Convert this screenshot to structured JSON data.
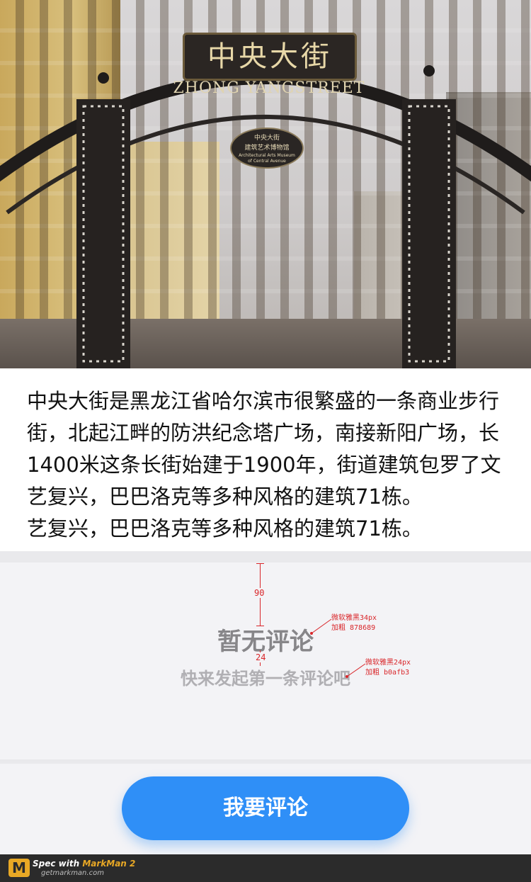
{
  "hero": {
    "sign_cn": "中央大街",
    "sign_en": "ZHONG YANGSTREET",
    "oval_line1": "中央大街",
    "oval_line2": "建筑艺术博物馆",
    "oval_line3": "Architectural Arts Museum",
    "oval_line4": "of Central Avenue"
  },
  "description": {
    "text": "中央大街是黑龙江省哈尔滨市很繁盛的一条商业步行街，北起江畔的防洪纪念塔广场，南接新阳广场，长1400米这条长街始建于1900年，街道建筑包罗了文艺复兴，巴巴洛克等多种风格的建筑71栋。\n艺复兴，巴巴洛克等多种风格的建筑71栋。"
  },
  "comments": {
    "empty_title": "暂无评论",
    "empty_subtitle": "快来发起第一条评论吧"
  },
  "spec": {
    "gap_top": "90",
    "gap_mid": "24",
    "title_note": "微软雅黑34px\n加粗 878689",
    "sub_note": "微软雅黑24px\n加粗 b0afb3"
  },
  "button": {
    "label": "我要评论"
  },
  "colors": {
    "title": "#878689",
    "subtitle": "#b0afb3",
    "button": "#2f8ff7"
  },
  "footer": {
    "logo": "M",
    "title_prefix": "Spec with ",
    "title_brand": "MarkMan 2",
    "url": "getmarkman.com"
  }
}
